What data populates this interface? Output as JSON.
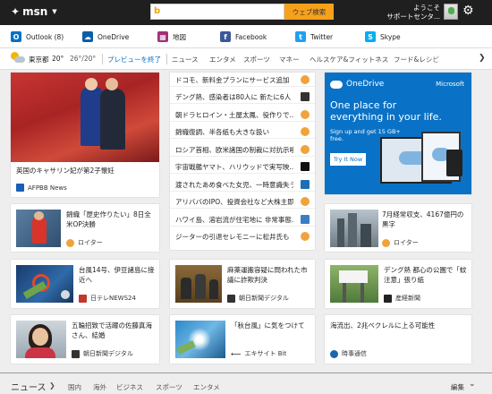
{
  "topbar": {
    "logo": "msn",
    "search_placeholder": "",
    "search_button": "ウェブ検索",
    "greeting_line1": "ようこそ",
    "greeting_line2": "サポートセンタ..."
  },
  "apps": [
    {
      "label": "Outlook (8)",
      "color": "#0072c6",
      "icon": "O",
      "name": "outlook"
    },
    {
      "label": "OneDrive",
      "color": "#0a5ea8",
      "icon": "☁",
      "name": "onedrive"
    },
    {
      "label": "地図",
      "color": "#a0307a",
      "icon": "▦",
      "name": "maps"
    },
    {
      "label": "Facebook",
      "color": "#3b5998",
      "icon": "f",
      "name": "facebook"
    },
    {
      "label": "Twitter",
      "color": "#1da1f2",
      "icon": "t",
      "name": "twitter"
    },
    {
      "label": "Skype",
      "color": "#00aff0",
      "icon": "S",
      "name": "skype"
    }
  ],
  "weather": {
    "city": "東京都",
    "temp": "20°",
    "range": "26°/20°"
  },
  "nav": {
    "preview_end": "プレビューを終了",
    "categories": [
      "ニュース",
      "エンタメ",
      "スポーツ",
      "マネー",
      "ヘルスケア&フィットネス",
      "フード&レシピ"
    ]
  },
  "hero": {
    "title": "英国のキャサリン妃が第2子懐妊",
    "source": "AFPBB News"
  },
  "headlines": [
    {
      "text": "ドコモ、新料金プランにサービス追加",
      "color": "#f0a33a"
    },
    {
      "text": "デング熱、感染者は80人に 新たに6人",
      "color": "#333333"
    },
    {
      "text": "朝ドラヒロイン・土屋太鳳、役作りで...",
      "color": "#f0a33a"
    },
    {
      "text": "錦織復調、半各紙も大きな扱い",
      "color": "#f0a33a"
    },
    {
      "text": "ロシア首相、欧米諸国の制裁に対抗示唆",
      "color": "#f0a33a"
    },
    {
      "text": "宇宙戦艦ヤマト、ハリウッドで実写映...",
      "color": "#111111"
    },
    {
      "text": "渡されたあめ食べた女児、一時意識失う",
      "color": "#1b6fb5"
    },
    {
      "text": "アリババのIPO、投資会社など大株主即...",
      "color": "#f0a33a"
    },
    {
      "text": "ハワイ島、溶岩流が住宅地に 非常事態...",
      "color": "#3b7dc4"
    },
    {
      "text": "ジーターの引退セレモニーに松井氏も",
      "color": "#f0a33a"
    }
  ],
  "ad": {
    "brand": "OneDrive",
    "company": "Microsoft",
    "headline": "One place for everything in your life.",
    "sub": "Sign up and get 15 GB+ free.",
    "cta": "Try It Now"
  },
  "cards": [
    {
      "title": "錦織「歴史作りたい」8日全米OP決勝",
      "source": "ロイター",
      "name": "nishikori"
    },
    {
      "title": "7月経常収支、4167億円の黒字",
      "source": "ロイター",
      "name": "current-account"
    },
    {
      "title": "台風14号、伊豆諸島に接近へ",
      "source": "日テレNEWS24",
      "name": "typhoon"
    },
    {
      "title": "麻薬運搬容疑に問われた市議に詐欺判決",
      "source": "朝日新聞デジタル",
      "name": "court"
    },
    {
      "title": "デング熱 都心の公園で「蚊注意」張り紙",
      "source": "産経新聞",
      "name": "dengue"
    },
    {
      "title": "五輪招致で活躍の佐藤真海さん、結婚",
      "source": "朝日新聞デジタル",
      "name": "sato"
    },
    {
      "title": "「秋台風」に気をつけて",
      "source": "エキサイト Bit",
      "name": "autumn-typhoon"
    },
    {
      "title": "海流出、2兆ベクレルに上る可能性",
      "source": "時事通信",
      "name": "sea-outflow"
    }
  ],
  "footer": {
    "title": "ニュース",
    "categories": [
      "国内",
      "海外",
      "ビジネス",
      "スポーツ",
      "エンタメ"
    ],
    "edit": "編集"
  }
}
